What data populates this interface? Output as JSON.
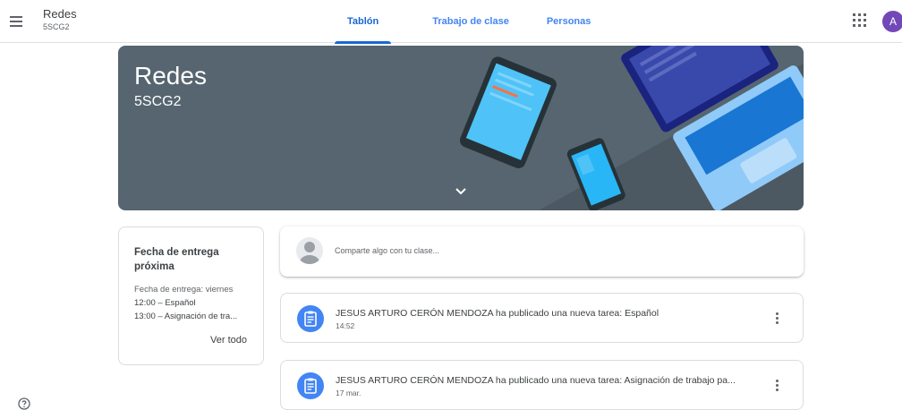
{
  "header": {
    "class_name": "Redes",
    "section": "5SCG2",
    "tabs": [
      {
        "label": "Tablón",
        "active": true
      },
      {
        "label": "Trabajo de clase",
        "active": false
      },
      {
        "label": "Personas",
        "active": false
      }
    ],
    "avatar_letter": "A"
  },
  "banner": {
    "title": "Redes",
    "subtitle": "5SCG2"
  },
  "upcoming": {
    "title": "Fecha de entrega próxima",
    "due_label": "Fecha de entrega: viernes",
    "items": [
      "12:00 – Español",
      "13:00 – Asignación de tra..."
    ],
    "view_all": "Ver todo"
  },
  "share": {
    "placeholder": "Comparte algo con tu clase..."
  },
  "posts": [
    {
      "title": "JESUS ARTURO CERÓN MENDOZA ha publicado una nueva tarea: Español",
      "time": "14:52"
    },
    {
      "title": "JESUS ARTURO CERÓN MENDOZA ha publicado una nueva tarea: Asignación de trabajo pa...",
      "time": "17 mar."
    }
  ],
  "colors": {
    "accent": "#1967d2",
    "banner": "#56656f",
    "avatar": "#7248b9",
    "post_icon": "#4285f4"
  },
  "icons": [
    "menu-icon",
    "apps-grid-icon",
    "chevron-down-icon",
    "assignment-icon",
    "more-vert-icon",
    "help-icon"
  ]
}
